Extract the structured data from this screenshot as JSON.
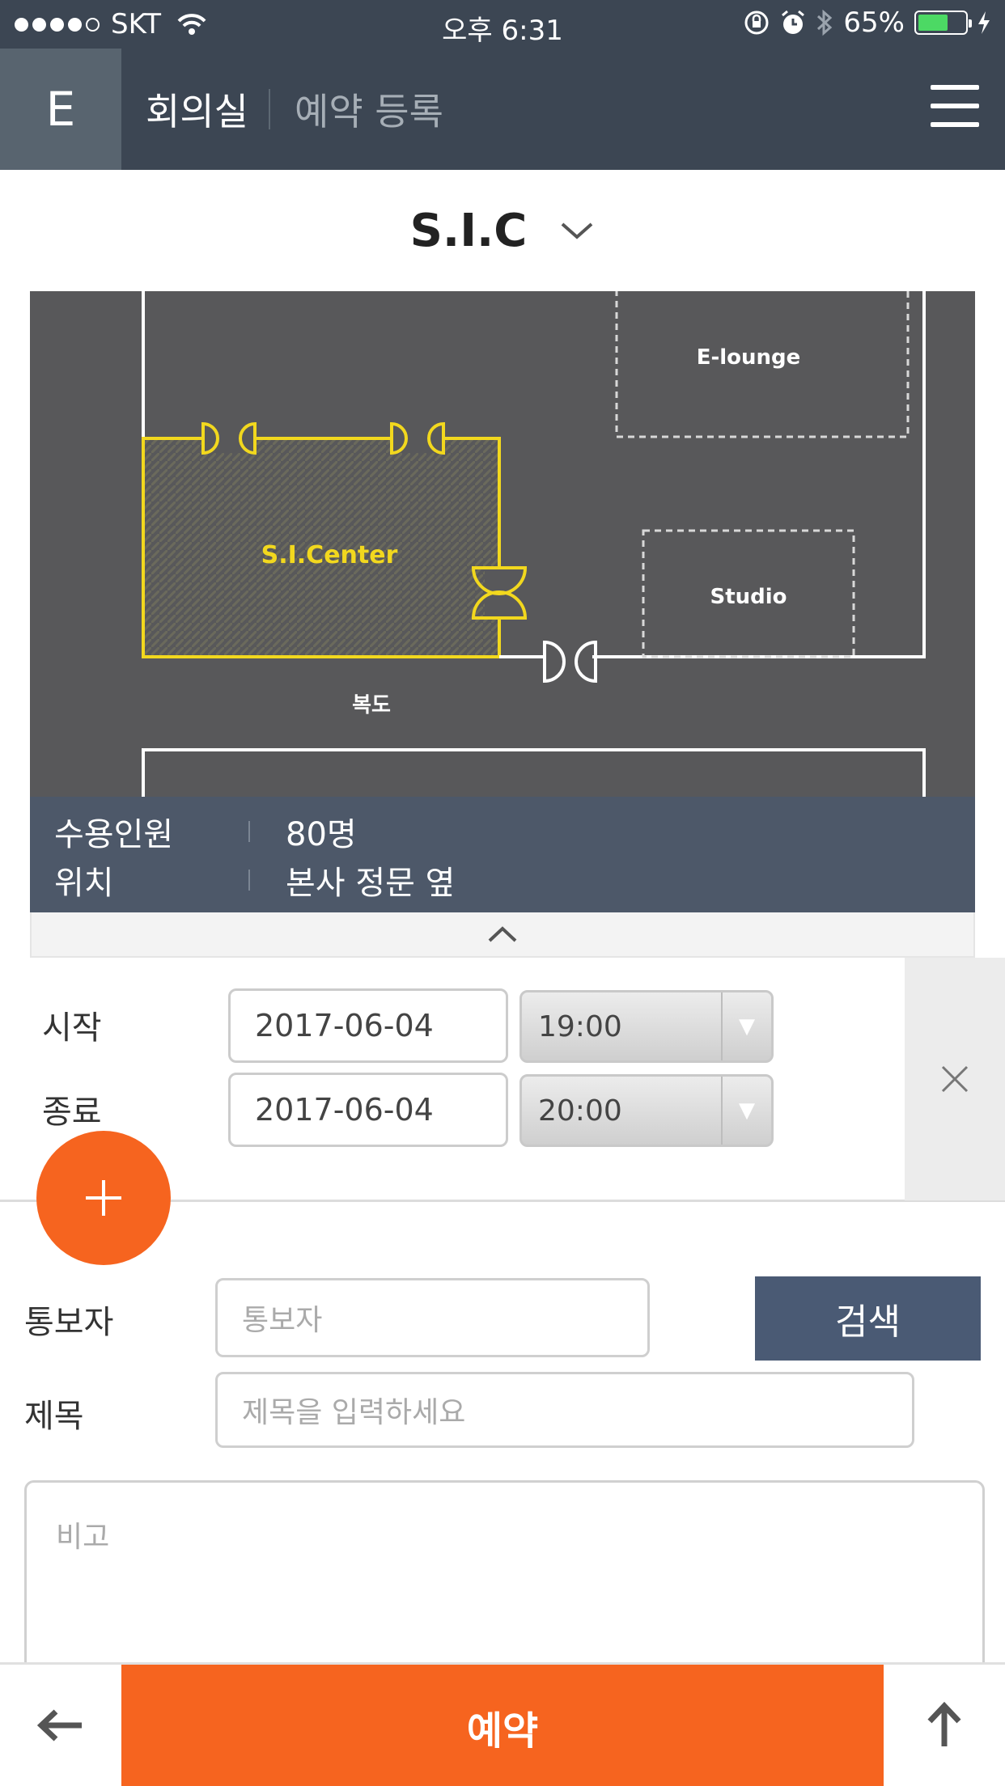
{
  "status_bar": {
    "carrier": "SKT",
    "time": "오후 6:31",
    "battery": "65%",
    "battery_level": 0.65,
    "icons": [
      "signal-dots",
      "wifi-icon",
      "rotation-lock-icon",
      "alarm-icon",
      "bluetooth-icon",
      "battery-icon",
      "charging-icon"
    ]
  },
  "header": {
    "logo": "E",
    "title": "회의실",
    "subtitle": "예약 등록",
    "menu_icon": "hamburger-menu-icon"
  },
  "room_select": {
    "selected": "S.I.C",
    "icon": "chevron-down-icon"
  },
  "floor_map": {
    "rooms": {
      "e_lounge": "E-lounge",
      "sic": "S.I.Center",
      "studio": "Studio",
      "corridor": "복도"
    },
    "colors": {
      "background": "#58585a",
      "highlight": "#f2d81e",
      "wall": "#ffffff"
    }
  },
  "room_info": {
    "rows": [
      {
        "label": "수용인원",
        "value": "80명"
      },
      {
        "label": "위치",
        "value": "본사 정문 옆"
      }
    ],
    "collapse_icon": "chevron-up-icon"
  },
  "schedule": {
    "start_label": "시작",
    "start_date": "2017-06-04",
    "start_time": "19:00",
    "end_label": "종료",
    "end_date": "2017-06-04",
    "end_time": "20:00",
    "clear_icon": "close-icon",
    "add_icon": "plus-icon"
  },
  "form": {
    "notifier_label": "통보자",
    "notifier_placeholder": "통보자",
    "search_button": "검색",
    "title_label": "제목",
    "title_placeholder": "제목을 입력하세요",
    "memo_placeholder": "비고"
  },
  "bottom_bar": {
    "back_icon": "arrow-left-icon",
    "reserve_button": "예약",
    "top_icon": "arrow-up-icon"
  },
  "colors": {
    "header_bg": "#3c4653",
    "accent": "#f6641f",
    "info_bg": "#4d5869",
    "search_button_bg": "#4a5a74"
  }
}
